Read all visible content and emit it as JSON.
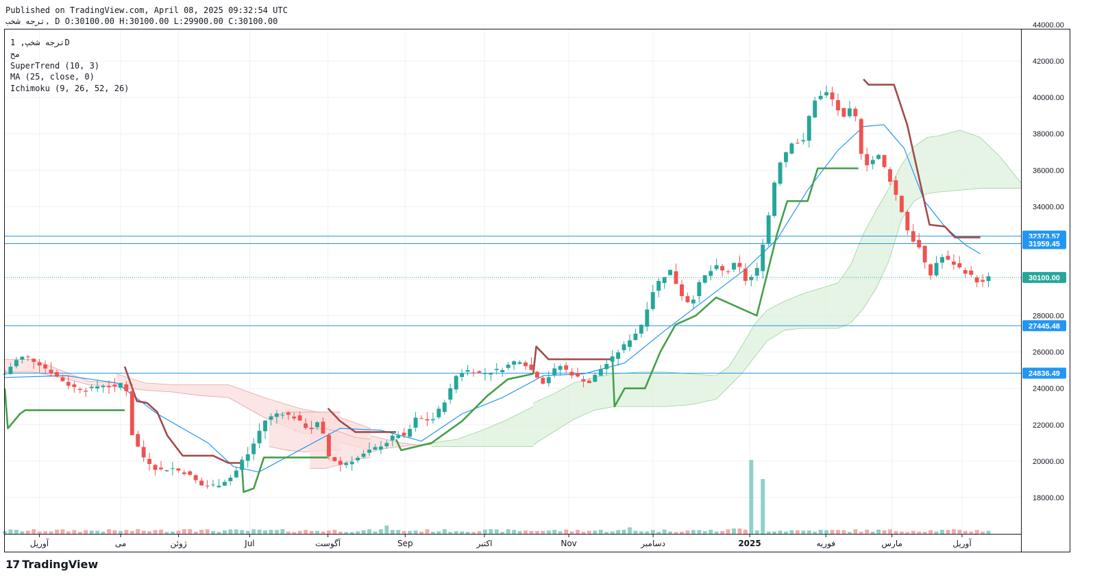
{
  "header": {
    "published": "Published on TradingView.com, April 08, 2025 09:32:54 UTC",
    "symbol_line_symbol": "ترجه شخپ",
    "symbol_line_rest": ", D O:30100.00 H:30100.00 L:29900.00 C:30100.00"
  },
  "legend": {
    "symbol_interval": "ترجه شخپ, 1D",
    "exchange": "مح",
    "supertrend": "SuperTrend (10, 3)",
    "ma": "MA (25, close, 0)",
    "ichimoku": "Ichimoku (9, 26, 52, 26)"
  },
  "brand": {
    "logo": "17",
    "name": "TradingView"
  },
  "colors": {
    "up": "#26a69a",
    "down": "#ef5350",
    "ma": "#2196f3",
    "supertrend_up": "#43a047",
    "supertrend_down": "#a04a4a",
    "level_line": "#2196f3",
    "cloud_green": "#dcf0dc",
    "cloud_red": "#fbdcdc",
    "last_price": "#26a69a"
  },
  "chart_data": {
    "type": "candlestick",
    "y_axis": {
      "min": 16000,
      "max": 44000,
      "ticks": [
        18000,
        20000,
        22000,
        24000,
        26000,
        28000,
        30000,
        32000,
        34000,
        36000,
        38000,
        40000,
        42000,
        44000
      ]
    },
    "x_axis": {
      "labels": [
        {
          "label": "آوریل",
          "pos": 0.034
        },
        {
          "label": "می",
          "pos": 0.114
        },
        {
          "label": "ژوئن",
          "pos": 0.171
        },
        {
          "label": "Jul",
          "pos": 0.241
        },
        {
          "label": "آگوست",
          "pos": 0.318
        },
        {
          "label": "Sep",
          "pos": 0.394
        },
        {
          "label": "اکتبر",
          "pos": 0.472
        },
        {
          "label": "Nov",
          "pos": 0.555
        },
        {
          "label": "دسامبر",
          "pos": 0.638
        },
        {
          "label": "2025",
          "pos": 0.733
        },
        {
          "label": "فوریه",
          "pos": 0.808
        },
        {
          "label": "مارس",
          "pos": 0.873
        },
        {
          "label": "آوریل",
          "pos": 0.942
        }
      ]
    },
    "levels": [
      {
        "name": "level-32373",
        "value": 32373.57,
        "label": "32373.57"
      },
      {
        "name": "level-31959",
        "value": 31959.45,
        "label": "31959.45"
      },
      {
        "name": "level-27445",
        "value": 27445.48,
        "label": "27445.48"
      },
      {
        "name": "level-24836",
        "value": 24836.49,
        "label": "24836.49"
      }
    ],
    "last_price": {
      "value": 30100,
      "label": "30100.00"
    },
    "price_path": [
      [
        0,
        24800
      ],
      [
        0.01,
        25500
      ],
      [
        0.02,
        25800
      ],
      [
        0.035,
        25300
      ],
      [
        0.05,
        24700
      ],
      [
        0.065,
        24100
      ],
      [
        0.08,
        23900
      ],
      [
        0.095,
        24200
      ],
      [
        0.11,
        24000
      ],
      [
        0.118,
        24600
      ],
      [
        0.125,
        21500
      ],
      [
        0.135,
        20300
      ],
      [
        0.15,
        19500
      ],
      [
        0.165,
        19600
      ],
      [
        0.18,
        19300
      ],
      [
        0.195,
        18600
      ],
      [
        0.21,
        18700
      ],
      [
        0.225,
        19200
      ],
      [
        0.233,
        20000
      ],
      [
        0.241,
        20500
      ],
      [
        0.255,
        22200
      ],
      [
        0.27,
        22700
      ],
      [
        0.285,
        22400
      ],
      [
        0.3,
        21700
      ],
      [
        0.31,
        22200
      ],
      [
        0.318,
        20300
      ],
      [
        0.33,
        19800
      ],
      [
        0.345,
        20100
      ],
      [
        0.36,
        20600
      ],
      [
        0.375,
        21000
      ],
      [
        0.385,
        21500
      ],
      [
        0.394,
        21300
      ],
      [
        0.405,
        22400
      ],
      [
        0.42,
        22200
      ],
      [
        0.435,
        23500
      ],
      [
        0.445,
        24800
      ],
      [
        0.455,
        25000
      ],
      [
        0.47,
        24800
      ],
      [
        0.49,
        25100
      ],
      [
        0.505,
        25600
      ],
      [
        0.515,
        25200
      ],
      [
        0.53,
        24300
      ],
      [
        0.545,
        25300
      ],
      [
        0.56,
        24700
      ],
      [
        0.575,
        24300
      ],
      [
        0.585,
        25000
      ],
      [
        0.595,
        25500
      ],
      [
        0.61,
        26400
      ],
      [
        0.625,
        27300
      ],
      [
        0.64,
        29700
      ],
      [
        0.655,
        30500
      ],
      [
        0.665,
        29200
      ],
      [
        0.675,
        28600
      ],
      [
        0.685,
        30000
      ],
      [
        0.7,
        30700
      ],
      [
        0.71,
        30300
      ],
      [
        0.72,
        31000
      ],
      [
        0.73,
        29800
      ],
      [
        0.74,
        30500
      ],
      [
        0.75,
        33000
      ],
      [
        0.76,
        36200
      ],
      [
        0.775,
        37600
      ],
      [
        0.785,
        37400
      ],
      [
        0.795,
        39800
      ],
      [
        0.81,
        40300
      ],
      [
        0.825,
        38800
      ],
      [
        0.835,
        39600
      ],
      [
        0.845,
        36200
      ],
      [
        0.86,
        36800
      ],
      [
        0.87,
        35600
      ],
      [
        0.88,
        34200
      ],
      [
        0.89,
        32400
      ],
      [
        0.9,
        31700
      ],
      [
        0.91,
        30100
      ],
      [
        0.92,
        31300
      ],
      [
        0.935,
        30800
      ],
      [
        0.945,
        30400
      ],
      [
        0.953,
        30100
      ],
      [
        0.96,
        29700
      ],
      [
        0.968,
        30100
      ]
    ],
    "ma_path": [
      [
        0,
        24600
      ],
      [
        0.06,
        24700
      ],
      [
        0.11,
        24300
      ],
      [
        0.15,
        22600
      ],
      [
        0.2,
        21000
      ],
      [
        0.225,
        19700
      ],
      [
        0.25,
        19400
      ],
      [
        0.29,
        20600
      ],
      [
        0.33,
        21800
      ],
      [
        0.37,
        21700
      ],
      [
        0.41,
        21100
      ],
      [
        0.45,
        22600
      ],
      [
        0.49,
        23500
      ],
      [
        0.53,
        24700
      ],
      [
        0.57,
        24800
      ],
      [
        0.61,
        25400
      ],
      [
        0.65,
        27200
      ],
      [
        0.69,
        28900
      ],
      [
        0.73,
        30600
      ],
      [
        0.76,
        32200
      ],
      [
        0.79,
        34900
      ],
      [
        0.82,
        37100
      ],
      [
        0.845,
        38400
      ],
      [
        0.865,
        38500
      ],
      [
        0.885,
        37200
      ],
      [
        0.905,
        34300
      ],
      [
        0.925,
        32900
      ],
      [
        0.945,
        31900
      ],
      [
        0.96,
        31400
      ]
    ],
    "supertrend_segments": [
      {
        "dir": "up",
        "points": [
          [
            0,
            24000
          ],
          [
            0.003,
            21800
          ],
          [
            0.015,
            22600
          ],
          [
            0.02,
            22800
          ],
          [
            0.118,
            22800
          ]
        ]
      },
      {
        "dir": "down",
        "points": [
          [
            0.118,
            25200
          ],
          [
            0.13,
            23300
          ],
          [
            0.14,
            23200
          ],
          [
            0.15,
            22700
          ],
          [
            0.16,
            21400
          ],
          [
            0.175,
            20300
          ],
          [
            0.205,
            20300
          ],
          [
            0.22,
            19900
          ],
          [
            0.233,
            19900
          ]
        ]
      },
      {
        "dir": "up",
        "points": [
          [
            0.233,
            20100
          ],
          [
            0.235,
            18300
          ],
          [
            0.245,
            18500
          ],
          [
            0.255,
            20200
          ],
          [
            0.318,
            20200
          ]
        ]
      },
      {
        "dir": "down",
        "points": [
          [
            0.318,
            22900
          ],
          [
            0.33,
            22200
          ],
          [
            0.345,
            21600
          ],
          [
            0.385,
            21600
          ]
        ]
      },
      {
        "dir": "up",
        "points": [
          [
            0.385,
            21200
          ],
          [
            0.39,
            20600
          ],
          [
            0.42,
            21000
          ],
          [
            0.45,
            22200
          ],
          [
            0.475,
            23600
          ],
          [
            0.495,
            24500
          ],
          [
            0.52,
            24800
          ]
        ]
      },
      {
        "dir": "down",
        "points": [
          [
            0.52,
            24800
          ],
          [
            0.523,
            26300
          ],
          [
            0.535,
            25600
          ],
          [
            0.598,
            25600
          ]
        ]
      },
      {
        "dir": "up",
        "points": [
          [
            0.598,
            25600
          ],
          [
            0.6,
            23000
          ],
          [
            0.61,
            24000
          ],
          [
            0.63,
            24000
          ],
          [
            0.645,
            26000
          ],
          [
            0.66,
            27500
          ],
          [
            0.68,
            28000
          ],
          [
            0.69,
            28500
          ],
          [
            0.7,
            29000
          ],
          [
            0.74,
            28000
          ],
          [
            0.76,
            32500
          ],
          [
            0.77,
            34300
          ],
          [
            0.79,
            34300
          ],
          [
            0.8,
            36100
          ],
          [
            0.84,
            36100
          ]
        ]
      },
      {
        "dir": "down",
        "points": [
          [
            0.845,
            41000
          ],
          [
            0.85,
            40700
          ],
          [
            0.875,
            40700
          ],
          [
            0.888,
            38500
          ],
          [
            0.9,
            35500
          ],
          [
            0.91,
            33000
          ],
          [
            0.925,
            32900
          ],
          [
            0.935,
            32300
          ],
          [
            0.96,
            32300
          ]
        ]
      }
    ],
    "ichimoku_cloud": [
      {
        "x": [
          0,
          0.11
        ],
        "top": [
          25600,
          25600,
          25000,
          24400,
          24300
        ],
        "bottom": [
          24900,
          24900,
          24600,
          24200,
          24100
        ],
        "color": "red"
      },
      {
        "x": [
          0.11,
          0.22
        ],
        "top": [
          24800,
          24300,
          24200,
          24200,
          24200
        ],
        "bottom": [
          24100,
          23900,
          23800,
          23600,
          23500
        ],
        "color": "red"
      },
      {
        "x": [
          0.22,
          0.36
        ],
        "top": [
          24200,
          23500,
          22900,
          22500,
          21800
        ],
        "bottom": [
          23500,
          22400,
          21600,
          21100,
          20600
        ],
        "color": "red"
      },
      {
        "x": [
          0.26,
          0.33
        ],
        "top": [
          22400,
          22700,
          22700,
          22700,
          22700
        ],
        "bottom": [
          20800,
          20600,
          20500,
          20600,
          20600
        ],
        "color": "red"
      },
      {
        "x": [
          0.3,
          0.36
        ],
        "top": [
          21800,
          21800,
          21600,
          21300,
          21200
        ],
        "bottom": [
          19600,
          19600,
          19800,
          20100,
          20200
        ],
        "color": "red"
      },
      {
        "x": [
          0.36,
          0.42
        ],
        "top": [
          21400,
          21200,
          21000,
          20900,
          20900
        ],
        "bottom": [
          20500,
          20700,
          20800,
          20900,
          20900
        ],
        "color": "red"
      },
      {
        "x": [
          0.42,
          0.52
        ],
        "top": [
          21000,
          21200,
          21700,
          22300,
          23000
        ],
        "bottom": [
          20800,
          20800,
          20800,
          20800,
          20800
        ],
        "color": "green"
      },
      {
        "x": [
          0.52,
          0.6
        ],
        "top": [
          23200,
          23700,
          24300,
          24600,
          24800
        ],
        "bottom": [
          20900,
          21600,
          22300,
          22800,
          23000
        ],
        "color": "green"
      },
      {
        "x": [
          0.6,
          0.7
        ],
        "top": [
          24800,
          24900,
          24900,
          24800,
          24700
        ],
        "bottom": [
          23000,
          23000,
          23000,
          23100,
          23400
        ],
        "color": "green"
      },
      {
        "x": [
          0.7,
          0.75
        ],
        "top": [
          24700,
          25200,
          26300,
          27500,
          28300
        ],
        "bottom": [
          23400,
          24100,
          24800,
          25700,
          26600
        ],
        "color": "green"
      },
      {
        "x": [
          0.75,
          0.82
        ],
        "top": [
          28300,
          28800,
          29200,
          29500,
          29800
        ],
        "bottom": [
          26600,
          27200,
          27300,
          27300,
          27300
        ],
        "color": "green"
      },
      {
        "x": [
          0.82,
          0.87
        ],
        "top": [
          29800,
          30800,
          32500,
          33800,
          35000
        ],
        "bottom": [
          27300,
          27600,
          28400,
          29500,
          31000
        ],
        "color": "green"
      },
      {
        "x": [
          0.87,
          0.92
        ],
        "top": [
          35000,
          36300,
          37300,
          37800,
          37900
        ],
        "bottom": [
          31000,
          33300,
          34300,
          34700,
          34800
        ],
        "color": "green"
      },
      {
        "x": [
          0.92,
          1.0
        ],
        "top": [
          37900,
          38200,
          37800,
          36700,
          35300
        ],
        "bottom": [
          34800,
          34900,
          35000,
          35000,
          35000
        ],
        "color": "green"
      }
    ],
    "volume_spikes": [
      {
        "x": 0.18,
        "value": 0.16
      },
      {
        "x": 0.375,
        "value": 0.28
      },
      {
        "x": 0.615,
        "value": 0.22
      },
      {
        "x": 0.734,
        "value": 0.58
      },
      {
        "x": 0.745,
        "value": 0.43
      },
      {
        "x": 0.72,
        "value": 0.18
      }
    ]
  }
}
